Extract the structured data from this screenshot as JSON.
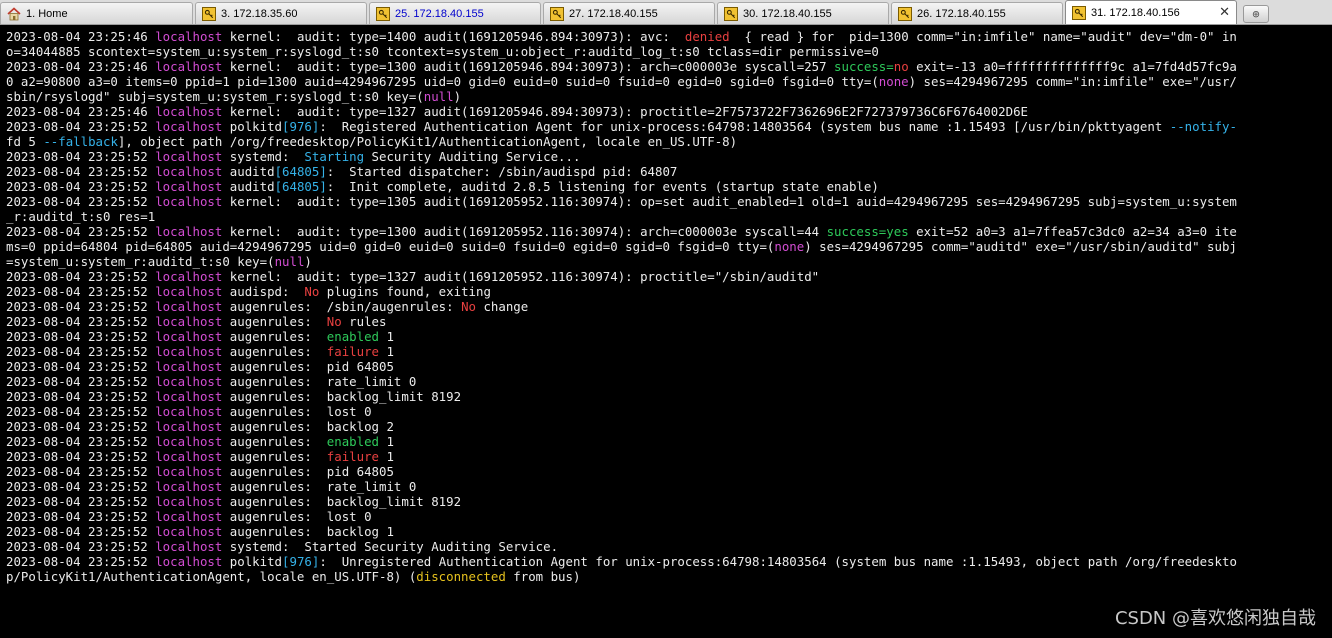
{
  "tabs": [
    {
      "label": "1. Home",
      "icon": "home-icon",
      "active": false,
      "highlight": false,
      "width": 193
    },
    {
      "label": "3. 172.18.35.60",
      "icon": "key-icon",
      "active": false,
      "highlight": false,
      "width": 172
    },
    {
      "label": "25. 172.18.40.155",
      "icon": "key-icon",
      "active": false,
      "highlight": true,
      "width": 172
    },
    {
      "label": "27. 172.18.40.155",
      "icon": "key-icon",
      "active": false,
      "highlight": false,
      "width": 172
    },
    {
      "label": "30. 172.18.40.155",
      "icon": "key-icon",
      "active": false,
      "highlight": false,
      "width": 172
    },
    {
      "label": "26. 172.18.40.155",
      "icon": "key-icon",
      "active": false,
      "highlight": false,
      "width": 172
    },
    {
      "label": "31. 172.18.40.156",
      "icon": "key-icon",
      "active": true,
      "highlight": false,
      "width": 172
    }
  ],
  "close_symbol": "✕",
  "new_tab_symbol": "⊕",
  "terminal": {
    "lines": [
      [
        [
          "2023-08-04 23:25:46 ",
          ""
        ],
        [
          "localhost",
          "host"
        ],
        [
          " kernel:  audit: type=1400 audit(1691205946.894:30973): avc:  ",
          ""
        ],
        [
          "denied",
          "red"
        ],
        [
          "  { read } for  pid=1300 comm=\"in:imfile\" name=\"audit\" dev=\"dm-0\" in",
          ""
        ]
      ],
      [
        [
          "o=34044885 scontext=system_u:system_r:syslogd_t:s0 tcontext=system_u:object_r:auditd_log_t:s0 tclass=dir permissive=0",
          ""
        ]
      ],
      [
        [
          "2023-08-04 23:25:46 ",
          ""
        ],
        [
          "localhost",
          "host"
        ],
        [
          " kernel:  audit: type=1300 audit(1691205946.894:30973): arch=c000003e syscall=257 ",
          ""
        ],
        [
          "success=",
          "green"
        ],
        [
          "no",
          "red"
        ],
        [
          " exit=-13 a0=ffffffffffffff9c a1=7fd4d57fc9a",
          ""
        ]
      ],
      [
        [
          "0 a2=90800 a3=0 items=0 ppid=1 pid=1300 auid=4294967295 uid=0 gid=0 euid=0 suid=0 fsuid=0 egid=0 sgid=0 fsgid=0 tty=(",
          ""
        ],
        [
          "none",
          "mag"
        ],
        [
          ") ses=4294967295 comm=\"in:imfile\" exe=\"/usr/",
          ""
        ]
      ],
      [
        [
          "sbin/rsyslogd\" subj=system_u:system_r:syslogd_t:s0 key=(",
          ""
        ],
        [
          "null",
          "mag"
        ],
        [
          ")",
          ""
        ]
      ],
      [
        [
          "2023-08-04 23:25:46 ",
          ""
        ],
        [
          "localhost",
          "host"
        ],
        [
          " kernel:  audit: type=1327 audit(1691205946.894:30973): proctitle=2F7573722F7362696E2F727379736C6F6764002D6E",
          ""
        ]
      ],
      [
        [
          "2023-08-04 23:25:52 ",
          ""
        ],
        [
          "localhost",
          "host"
        ],
        [
          " polkitd",
          ""
        ],
        [
          "[976]",
          "cyan"
        ],
        [
          ":  Registered Authentication Agent for unix-process:64798:14803564 (system bus name :1.15493 [/usr/bin/pkttyagent ",
          ""
        ],
        [
          "--notify-",
          "cyan"
        ]
      ],
      [
        [
          "fd",
          ""
        ],
        [
          " 5 ",
          ""
        ],
        [
          "--fallback",
          "cyan"
        ],
        [
          "], object path /org/freedesktop/PolicyKit1/AuthenticationAgent, locale en_US.UTF-8)",
          ""
        ]
      ],
      [
        [
          "2023-08-04 23:25:52 ",
          ""
        ],
        [
          "localhost",
          "host"
        ],
        [
          " systemd:  ",
          ""
        ],
        [
          "Starting",
          "cyan"
        ],
        [
          " Security Auditing Service...",
          ""
        ]
      ],
      [
        [
          "2023-08-04 23:25:52 ",
          ""
        ],
        [
          "localhost",
          "host"
        ],
        [
          " auditd",
          ""
        ],
        [
          "[64805]",
          "cyan"
        ],
        [
          ":  Started dispatcher: /sbin/audispd pid: 64807",
          ""
        ]
      ],
      [
        [
          "2023-08-04 23:25:52 ",
          ""
        ],
        [
          "localhost",
          "host"
        ],
        [
          " auditd",
          ""
        ],
        [
          "[64805]",
          "cyan"
        ],
        [
          ":  Init complete, auditd 2.8.5 listening for events (startup state enable)",
          ""
        ]
      ],
      [
        [
          "2023-08-04 23:25:52 ",
          ""
        ],
        [
          "localhost",
          "host"
        ],
        [
          " kernel:  audit: type=1305 audit(1691205952.116:30974): op=set audit_enabled=1 old=1 auid=4294967295 ses=4294967295 subj=system_u:system",
          ""
        ]
      ],
      [
        [
          "_r:auditd_t:s0 res=1",
          ""
        ]
      ],
      [
        [
          "2023-08-04 23:25:52 ",
          ""
        ],
        [
          "localhost",
          "host"
        ],
        [
          " kernel:  audit: type=1300 audit(1691205952.116:30974): arch=c000003e syscall=44 ",
          ""
        ],
        [
          "success=yes",
          "green"
        ],
        [
          " exit=52 a0=3 a1=7ffea57c3dc0 a2=34 a3=0 ite",
          ""
        ]
      ],
      [
        [
          "ms=0 ppid=64804 pid=64805 auid=4294967295 uid=0 gid=0 euid=0 suid=0 fsuid=0 egid=0 sgid=0 fsgid=0 tty=(",
          ""
        ],
        [
          "none",
          "mag"
        ],
        [
          ") ses=4294967295 comm=\"auditd\" exe=\"/usr/sbin/auditd\" subj",
          ""
        ]
      ],
      [
        [
          "=system_u:system_r:auditd_t:s0 key=(",
          ""
        ],
        [
          "null",
          "mag"
        ],
        [
          ")",
          ""
        ]
      ],
      [
        [
          "2023-08-04 23:25:52 ",
          ""
        ],
        [
          "localhost",
          "host"
        ],
        [
          " kernel:  audit: type=1327 audit(1691205952.116:30974): proctitle=\"/sbin/auditd\"",
          ""
        ]
      ],
      [
        [
          "2023-08-04 23:25:52 ",
          ""
        ],
        [
          "localhost",
          "host"
        ],
        [
          " audispd:  ",
          ""
        ],
        [
          "No",
          "red"
        ],
        [
          " plugins found, exiting",
          ""
        ]
      ],
      [
        [
          "2023-08-04 23:25:52 ",
          ""
        ],
        [
          "localhost",
          "host"
        ],
        [
          " augenrules:  /sbin/augenrules: ",
          ""
        ],
        [
          "No",
          "red"
        ],
        [
          " change",
          ""
        ]
      ],
      [
        [
          "2023-08-04 23:25:52 ",
          ""
        ],
        [
          "localhost",
          "host"
        ],
        [
          " augenrules:  ",
          ""
        ],
        [
          "No",
          "red"
        ],
        [
          " rules",
          ""
        ]
      ],
      [
        [
          "2023-08-04 23:25:52 ",
          ""
        ],
        [
          "localhost",
          "host"
        ],
        [
          " augenrules:  ",
          ""
        ],
        [
          "enabled",
          "green"
        ],
        [
          " 1",
          ""
        ]
      ],
      [
        [
          "2023-08-04 23:25:52 ",
          ""
        ],
        [
          "localhost",
          "host"
        ],
        [
          " augenrules:  ",
          ""
        ],
        [
          "failure",
          "red"
        ],
        [
          " 1",
          ""
        ]
      ],
      [
        [
          "2023-08-04 23:25:52 ",
          ""
        ],
        [
          "localhost",
          "host"
        ],
        [
          " augenrules:  pid 64805",
          ""
        ]
      ],
      [
        [
          "2023-08-04 23:25:52 ",
          ""
        ],
        [
          "localhost",
          "host"
        ],
        [
          " augenrules:  rate_limit 0",
          ""
        ]
      ],
      [
        [
          "2023-08-04 23:25:52 ",
          ""
        ],
        [
          "localhost",
          "host"
        ],
        [
          " augenrules:  backlog_limit 8192",
          ""
        ]
      ],
      [
        [
          "2023-08-04 23:25:52 ",
          ""
        ],
        [
          "localhost",
          "host"
        ],
        [
          " augenrules:  lost 0",
          ""
        ]
      ],
      [
        [
          "2023-08-04 23:25:52 ",
          ""
        ],
        [
          "localhost",
          "host"
        ],
        [
          " augenrules:  backlog 2",
          ""
        ]
      ],
      [
        [
          "2023-08-04 23:25:52 ",
          ""
        ],
        [
          "localhost",
          "host"
        ],
        [
          " augenrules:  ",
          ""
        ],
        [
          "enabled",
          "green"
        ],
        [
          " 1",
          ""
        ]
      ],
      [
        [
          "2023-08-04 23:25:52 ",
          ""
        ],
        [
          "localhost",
          "host"
        ],
        [
          " augenrules:  ",
          ""
        ],
        [
          "failure",
          "red"
        ],
        [
          " 1",
          ""
        ]
      ],
      [
        [
          "2023-08-04 23:25:52 ",
          ""
        ],
        [
          "localhost",
          "host"
        ],
        [
          " augenrules:  pid 64805",
          ""
        ]
      ],
      [
        [
          "2023-08-04 23:25:52 ",
          ""
        ],
        [
          "localhost",
          "host"
        ],
        [
          " augenrules:  rate_limit 0",
          ""
        ]
      ],
      [
        [
          "2023-08-04 23:25:52 ",
          ""
        ],
        [
          "localhost",
          "host"
        ],
        [
          " augenrules:  backlog_limit 8192",
          ""
        ]
      ],
      [
        [
          "2023-08-04 23:25:52 ",
          ""
        ],
        [
          "localhost",
          "host"
        ],
        [
          " augenrules:  lost 0",
          ""
        ]
      ],
      [
        [
          "2023-08-04 23:25:52 ",
          ""
        ],
        [
          "localhost",
          "host"
        ],
        [
          " augenrules:  backlog 1",
          ""
        ]
      ],
      [
        [
          "2023-08-04 23:25:52 ",
          ""
        ],
        [
          "localhost",
          "host"
        ],
        [
          " systemd:  Started Security Auditing Service.",
          ""
        ]
      ],
      [
        [
          "2023-08-04 23:25:52 ",
          ""
        ],
        [
          "localhost",
          "host"
        ],
        [
          " polkitd",
          ""
        ],
        [
          "[976]",
          "cyan"
        ],
        [
          ":  Unregistered Authentication Agent for unix-process:64798:14803564 (system bus name :1.15493, object path /org/freedeskto",
          ""
        ]
      ],
      [
        [
          "p/PolicyKit1/AuthenticationAgent, locale en_US.UTF-8) (",
          ""
        ],
        [
          "disconnected",
          "yel"
        ],
        [
          " from bus)",
          ""
        ]
      ]
    ]
  },
  "watermark": "CSDN @喜欢悠闲独自哉",
  "colors": {
    "host": "#d24dd2",
    "cyan": "#35b2e8",
    "red": "#e84040",
    "green": "#2ec95a",
    "magenta": "#d24dd2",
    "yellow": "#e6c21e"
  }
}
